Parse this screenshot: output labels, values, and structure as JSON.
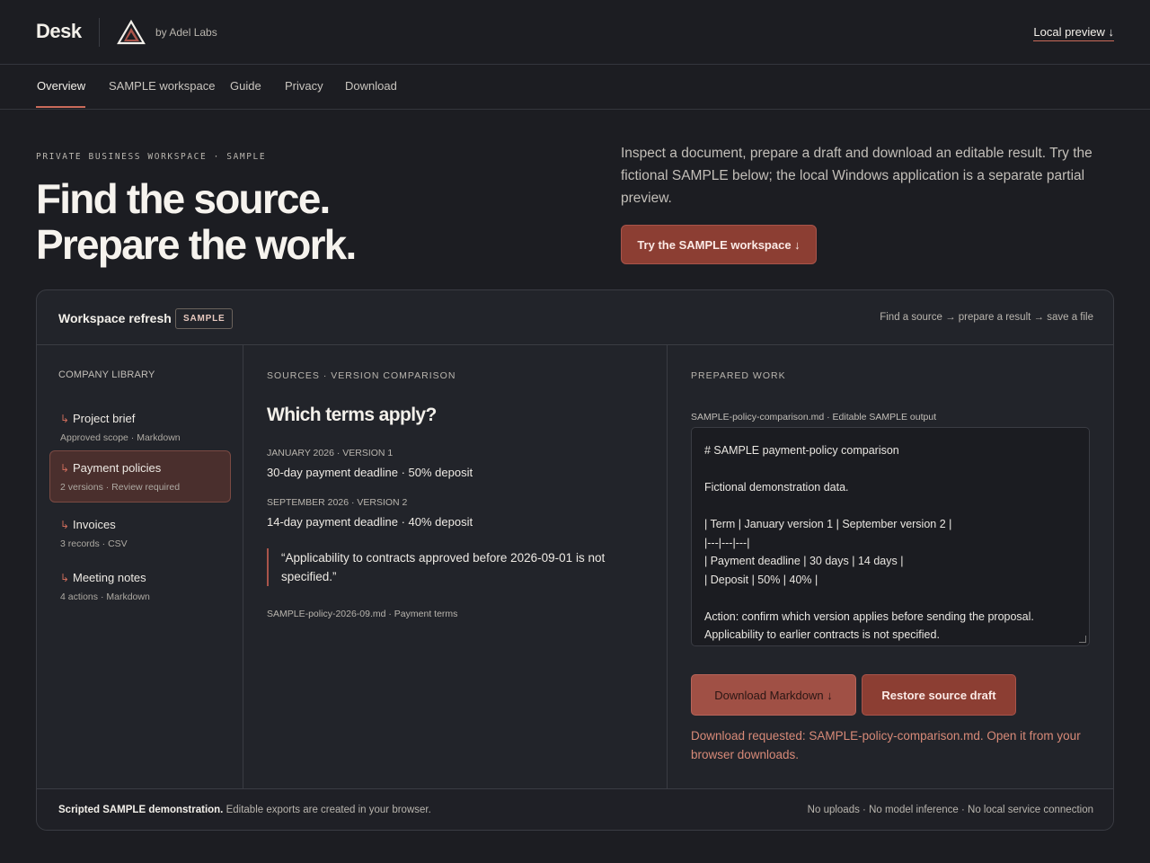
{
  "header": {
    "brand": "Desk",
    "byline": "by Adel Labs",
    "local_preview": "Local preview ↓"
  },
  "nav": {
    "items": [
      "Overview",
      "SAMPLE workspace",
      "Guide",
      "Privacy",
      "Download"
    ],
    "active": "Overview"
  },
  "hero": {
    "eyebrow": "PRIVATE BUSINESS WORKSPACE · SAMPLE",
    "title_line1": "Find the source.",
    "title_line2": "Prepare the work.",
    "description": "Inspect a document, prepare a draft and download an editable result. Try the fictional SAMPLE below; the local Windows application is a separate partial preview.",
    "cta": "Try the SAMPLE workspace ↓"
  },
  "workspace": {
    "title": "Workspace refresh",
    "badge": "SAMPLE",
    "flow": "Find a source → prepare a result → save a file",
    "library": {
      "label": "COMPANY LIBRARY",
      "items": [
        {
          "name": "Project brief",
          "meta": "Approved scope · Markdown"
        },
        {
          "name": "Payment policies",
          "meta": "2 versions · Review required",
          "active": true
        },
        {
          "name": "Invoices",
          "meta": "3 records · CSV"
        },
        {
          "name": "Meeting notes",
          "meta": "4 actions · Markdown"
        }
      ]
    },
    "sources": {
      "label": "SOURCES · VERSION COMPARISON",
      "question": "Which terms apply?",
      "versions": [
        {
          "label": "JANUARY 2026 · VERSION 1",
          "text": "30-day payment deadline · 50% deposit"
        },
        {
          "label": "SEPTEMBER 2026 · VERSION 2",
          "text": "14-day payment deadline · 40% deposit"
        }
      ],
      "quote": "“Applicability to contracts approved before 2026-09-01 is not specified.”",
      "file": "SAMPLE-policy-2026-09.md · Payment terms"
    },
    "prepared": {
      "label": "PREPARED WORK",
      "file": "SAMPLE-policy-comparison.md · Editable SAMPLE output",
      "editor_lines": [
        "# SAMPLE payment-policy comparison",
        "",
        "Fictional demonstration data.",
        "",
        "| Term | January version 1 | September version 2 |",
        "|---|---|---|",
        "| Payment deadline | 30 days | 14 days |",
        "| Deposit | 50% | 40% |",
        "",
        "Action: confirm which version applies before sending the proposal.",
        "Applicability to earlier contracts is not specified."
      ],
      "download_button": "Download Markdown ↓",
      "restore_button": "Restore source draft",
      "status": "Download requested: SAMPLE-policy-comparison.md. Open it from your browser downloads."
    },
    "footer": {
      "left_bold": "Scripted SAMPLE demonstration.",
      "left_rest": " Editable exports are created in your browser.",
      "right": "No uploads · No model inference · No local service connection"
    }
  },
  "colors": {
    "background": "#1c1d22",
    "panel": "#22242a",
    "accent": "#c96a5a",
    "button": "#8c3e33"
  }
}
